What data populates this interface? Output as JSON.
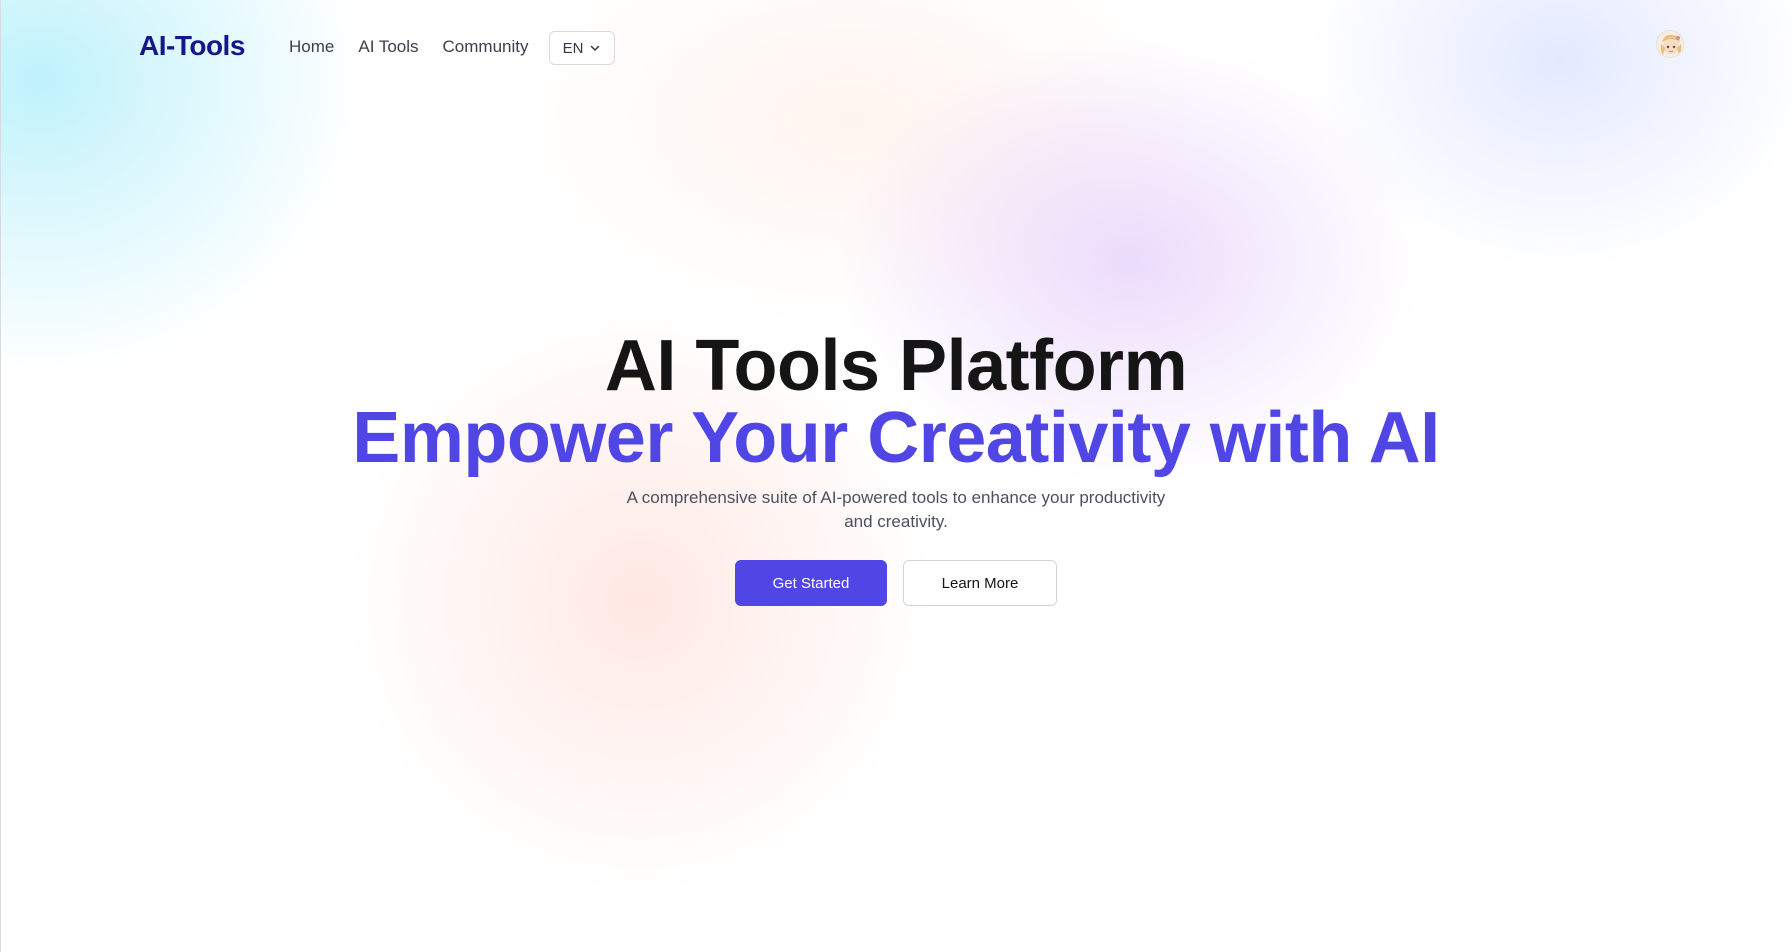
{
  "header": {
    "logo": "AI-Tools",
    "nav": [
      {
        "label": "Home"
      },
      {
        "label": "AI Tools"
      },
      {
        "label": "Community"
      }
    ],
    "language": {
      "selected": "EN"
    }
  },
  "hero": {
    "title": "AI Tools Platform",
    "subtitle": "Empower Your Creativity with AI",
    "description": "A comprehensive suite of AI-powered tools to enhance your productivity and creativity.",
    "primary_button": "Get Started",
    "secondary_button": "Learn More"
  },
  "colors": {
    "brand": "#16168a",
    "accent": "#4f46e5",
    "title": "#151515",
    "body_text": "#4b5060"
  },
  "icons": {
    "language_chevron": "chevron-down-icon",
    "avatar": "user-avatar"
  }
}
